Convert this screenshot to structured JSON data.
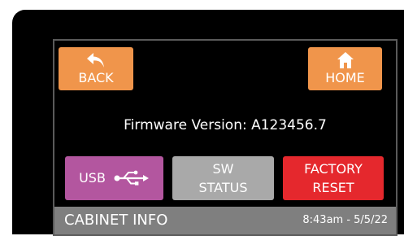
{
  "header": {
    "back_label": "BACK",
    "home_label": "HOME"
  },
  "firmware": {
    "text": "Firmware Version: A123456.7"
  },
  "actions": {
    "usb_label": "USB",
    "sw_status_line1": "SW",
    "sw_status_line2": "STATUS",
    "factory_reset_line1": "FACTORY",
    "factory_reset_line2": "RESET"
  },
  "footer": {
    "title": "CABINET INFO",
    "datetime": "8:43am - 5/5/22"
  },
  "icons": {
    "back": "back-arrow-icon",
    "home": "home-icon",
    "usb": "usb-icon"
  },
  "colors": {
    "nav_button": "#f0954b",
    "usb_button": "#b3569f",
    "sw_status_button": "#a9a9a9",
    "factory_reset_button": "#e5282d",
    "footer_bar": "#7f7f7f",
    "background": "#000000"
  }
}
